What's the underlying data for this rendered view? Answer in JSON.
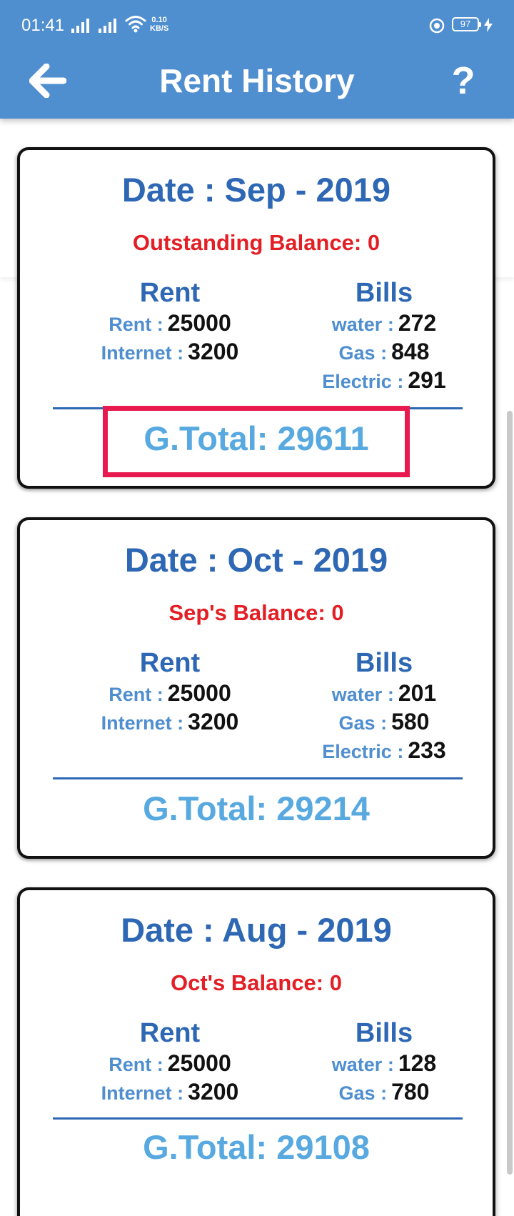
{
  "status_bar": {
    "time": "01:41",
    "net_speed_value": "0.10",
    "net_speed_unit": "KB/S",
    "battery": "97"
  },
  "app_bar": {
    "title": "Rent History",
    "help": "?"
  },
  "cards": [
    {
      "date": "Date : Sep - 2019",
      "balance": "Outstanding Balance: 0",
      "rent_heading": "Rent",
      "bills_heading": "Bills",
      "rent_items": [
        {
          "label": "Rent :",
          "value": "25000"
        },
        {
          "label": "Internet :",
          "value": "3200"
        }
      ],
      "bills_items": [
        {
          "label": "water :",
          "value": "272"
        },
        {
          "label": "Gas :",
          "value": "848"
        },
        {
          "label": "Electric :",
          "value": "291"
        }
      ],
      "total": "G.Total: 29611"
    },
    {
      "date": "Date : Oct - 2019",
      "balance": "Sep's Balance: 0",
      "rent_heading": "Rent",
      "bills_heading": "Bills",
      "rent_items": [
        {
          "label": "Rent :",
          "value": "25000"
        },
        {
          "label": "Internet :",
          "value": "3200"
        }
      ],
      "bills_items": [
        {
          "label": "water :",
          "value": "201"
        },
        {
          "label": "Gas :",
          "value": "580"
        },
        {
          "label": "Electric :",
          "value": "233"
        }
      ],
      "total": "G.Total: 29214"
    },
    {
      "date": "Date : Aug - 2019",
      "balance": "Oct's Balance: 0",
      "rent_heading": "Rent",
      "bills_heading": "Bills",
      "rent_items": [
        {
          "label": "Rent :",
          "value": "25000"
        },
        {
          "label": "Internet :",
          "value": "3200"
        }
      ],
      "bills_items": [
        {
          "label": "water :",
          "value": "128"
        },
        {
          "label": "Gas :",
          "value": "780"
        }
      ],
      "total": "G.Total: 29108"
    }
  ],
  "colors": {
    "app_bar": "#4f8ecf",
    "date_heading": "#2e67b3",
    "balance": "#e31e24",
    "item_label": "#4f8ecf",
    "grand_total": "#57a9e0",
    "highlight_box": "#e8194f"
  },
  "icons": {
    "back": "arrow-left-icon",
    "help": "question-mark-icon"
  }
}
